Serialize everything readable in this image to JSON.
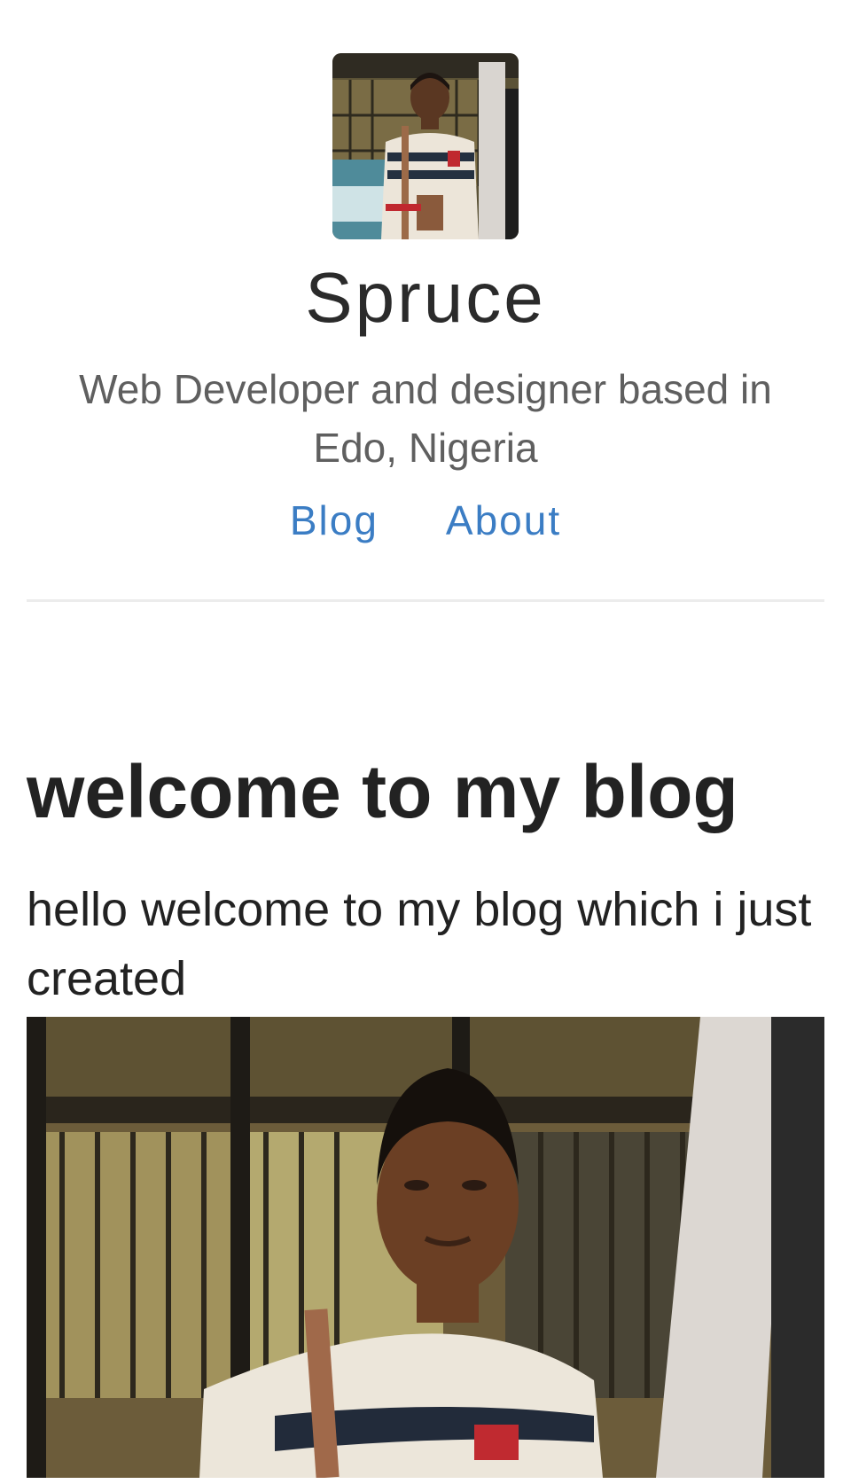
{
  "header": {
    "avatar_icon": "profile-photo",
    "site_title": "Spruce",
    "tagline": "Web Developer and designer based in Edo, Nigeria"
  },
  "nav": {
    "items": [
      {
        "label": "Blog"
      },
      {
        "label": "About"
      }
    ]
  },
  "post": {
    "title": "welcome to my blog",
    "body": "hello welcome to my blog which i just created",
    "image_icon": "post-photo"
  },
  "colors": {
    "link": "#3b7dc4",
    "title_text": "#2b2b2b",
    "tagline_text": "#5f5f5f",
    "body_text": "#222222",
    "divider": "#ececec"
  }
}
